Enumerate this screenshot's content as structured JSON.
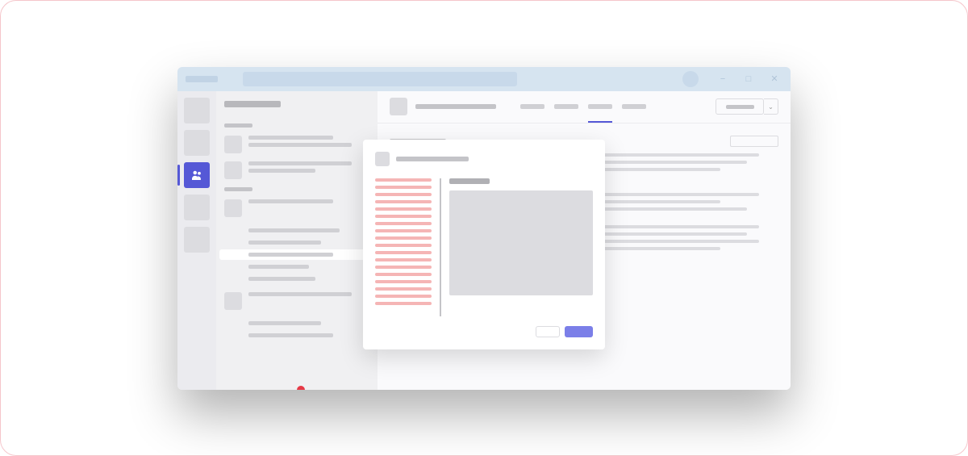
{
  "window": {
    "minimize": "−",
    "maximize": "□",
    "close": "✕"
  },
  "rail": {
    "items": [
      "activity",
      "chat",
      "teams",
      "calendar",
      "apps"
    ],
    "activeIndex": 2
  },
  "tabs": {
    "activeIndex": 2
  },
  "header": {
    "dropdown": "⌄"
  },
  "modal": {
    "cancel": "",
    "confirm": ""
  },
  "colors": {
    "accent": "#5558d6",
    "titlebar": "#d6e4f0",
    "redHighlight": "#f5b5b5",
    "redDot": "#e63946"
  }
}
